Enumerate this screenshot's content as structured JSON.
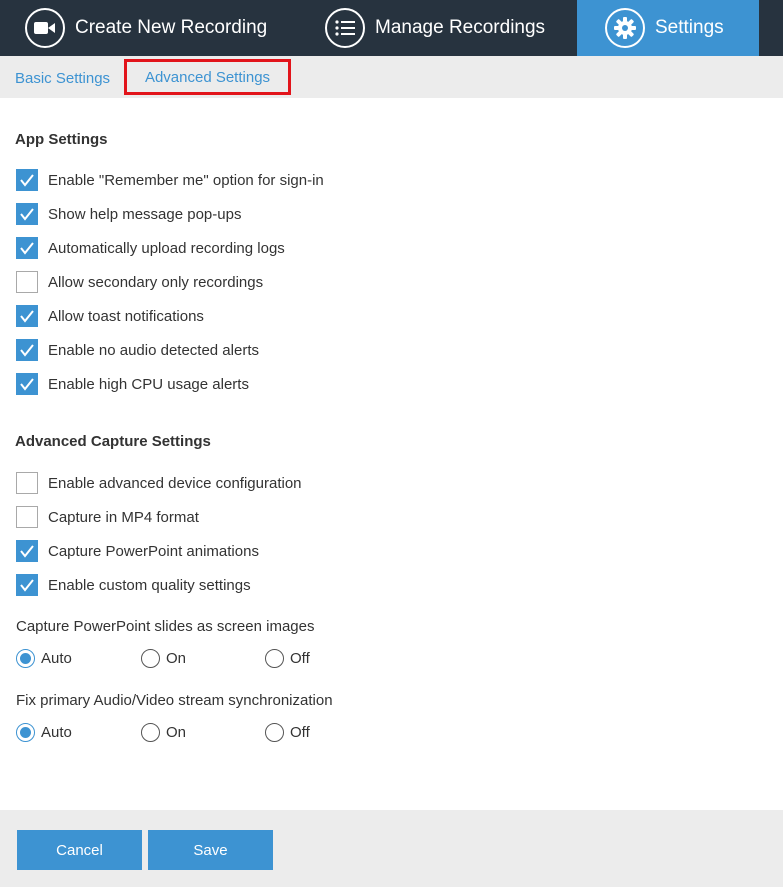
{
  "nav": {
    "create_label": "Create New Recording",
    "manage_label": "Manage Recordings",
    "settings_label": "Settings"
  },
  "subtabs": {
    "basic": "Basic Settings",
    "advanced": "Advanced Settings"
  },
  "app_settings": {
    "title": "App Settings",
    "items": [
      {
        "label": "Enable \"Remember me\" option for sign-in",
        "checked": true
      },
      {
        "label": "Show help message pop-ups",
        "checked": true
      },
      {
        "label": "Automatically upload recording logs",
        "checked": true
      },
      {
        "label": "Allow secondary only recordings",
        "checked": false
      },
      {
        "label": "Allow toast notifications",
        "checked": true
      },
      {
        "label": "Enable no audio detected alerts",
        "checked": true
      },
      {
        "label": "Enable high CPU usage alerts",
        "checked": true
      }
    ]
  },
  "capture_settings": {
    "title": "Advanced Capture Settings",
    "items": [
      {
        "label": "Enable advanced device configuration",
        "checked": false
      },
      {
        "label": "Capture in MP4 format",
        "checked": false
      },
      {
        "label": "Capture PowerPoint animations",
        "checked": true
      },
      {
        "label": "Enable custom quality settings",
        "checked": true
      }
    ]
  },
  "ppt_slides": {
    "title": "Capture PowerPoint slides as screen images",
    "options": [
      "Auto",
      "On",
      "Off"
    ],
    "selected": "Auto"
  },
  "av_sync": {
    "title": "Fix primary Audio/Video stream synchronization",
    "options": [
      "Auto",
      "On",
      "Off"
    ],
    "selected": "Auto"
  },
  "footer": {
    "cancel_label": "Cancel",
    "save_label": "Save"
  },
  "colors": {
    "accent": "#3d93d2",
    "nav_bg": "#27333f",
    "highlight_border": "#e2141b"
  }
}
